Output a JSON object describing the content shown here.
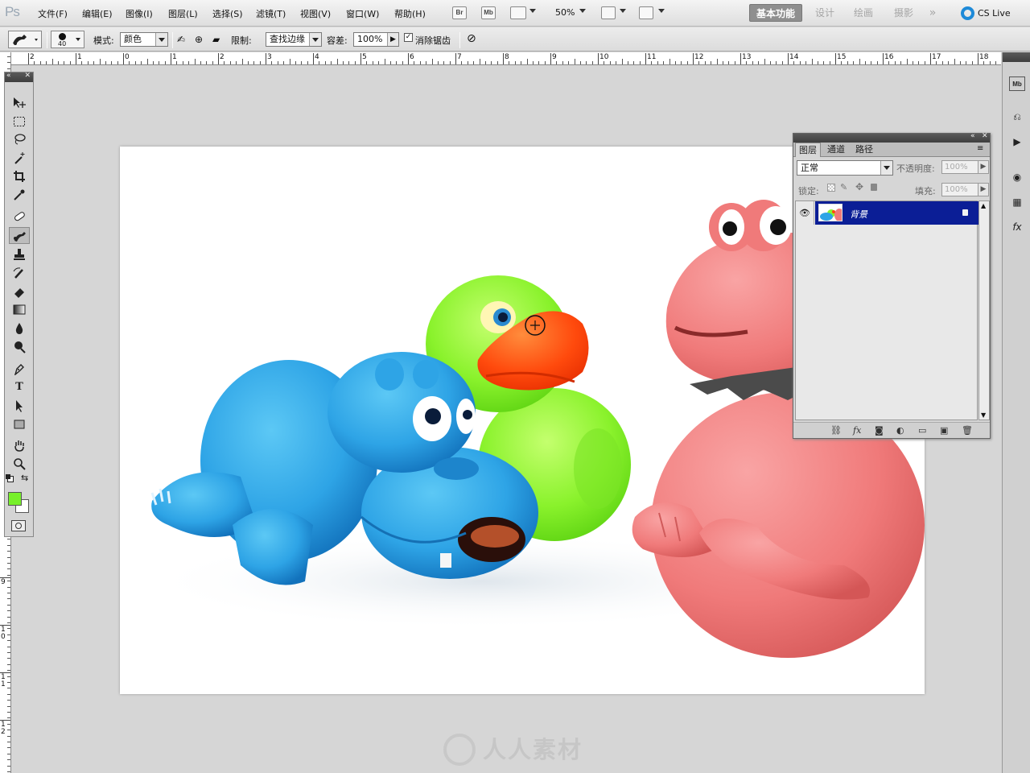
{
  "app": {
    "logo": "Ps"
  },
  "menu": {
    "items": [
      "文件(F)",
      "编辑(E)",
      "图像(I)",
      "图层(L)",
      "选择(S)",
      "滤镜(T)",
      "视图(V)",
      "窗口(W)",
      "帮助(H)"
    ],
    "bridge_button": "Br",
    "minibridge_button": "Mb",
    "zoom": "50%",
    "workspaces": [
      "基本功能",
      "设计",
      "绘画",
      "摄影"
    ],
    "more_workspaces": "»",
    "cslive": "CS Live"
  },
  "options": {
    "brush_size": "40",
    "mode_label": "模式:",
    "mode_value": "颜色",
    "limit_label": "限制:",
    "limit_value": "查找边缘",
    "tolerance_label": "容差:",
    "tolerance_value": "100%",
    "antialias_label": "消除锯齿",
    "antialias_checked": "✓"
  },
  "ruler": {
    "h_labels": [
      "2",
      "1",
      "0",
      "1",
      "2",
      "3",
      "4",
      "5",
      "6",
      "7",
      "8",
      "9",
      "10",
      "11",
      "12",
      "13",
      "14",
      "15",
      "16",
      "17",
      "18"
    ],
    "v_labels": [
      "9",
      "1 0",
      "1 1",
      "1 2"
    ]
  },
  "tools": {
    "items": [
      "move",
      "marquee",
      "lasso",
      "quick-select",
      "crop",
      "eyedropper",
      "healing",
      "color-replacement",
      "clone-stamp",
      "history-brush",
      "eraser",
      "gradient",
      "blur",
      "dodge",
      "pen",
      "type",
      "path-select",
      "rectangle",
      "hand",
      "zoom"
    ],
    "active": "color-replacement",
    "type_glyph": "T",
    "foreground_color": "#77f02a",
    "background_color": "#ffffff"
  },
  "layers_panel": {
    "tabs": [
      "图层",
      "通道",
      "路径"
    ],
    "blend_mode": "正常",
    "opacity_label": "不透明度:",
    "opacity_value": "100%",
    "lock_label": "锁定:",
    "fill_label": "填充:",
    "fill_value": "100%",
    "layers": [
      {
        "name": "背景",
        "visible": true,
        "locked": true,
        "selected": true
      }
    ],
    "footer_fx": "fx"
  },
  "colors": {
    "selection": "#0b1e96",
    "hippo": "#2ea4e6",
    "duck": "#8af22c",
    "beak": "#ff4a0d",
    "frog": "#f07a7a"
  },
  "watermark": "人人素材"
}
